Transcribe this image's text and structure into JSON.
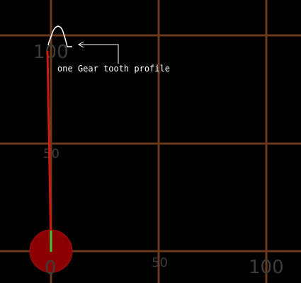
{
  "canvas": {
    "background": "#000000",
    "grid_color": "#6b3a1f",
    "label_color": "#3c3c3c"
  },
  "axis_labels": {
    "origin": "0",
    "y_mid": "50",
    "y_top": "100",
    "x_mid": "50",
    "x_right": "100"
  },
  "annotation": {
    "text": "one Gear tooth profile"
  },
  "colors": {
    "pivot_fill": "#8b0000",
    "pointer_line": "#cc1a0f",
    "marker_green": "#33cc33",
    "profile_stroke": "#ffffff"
  }
}
